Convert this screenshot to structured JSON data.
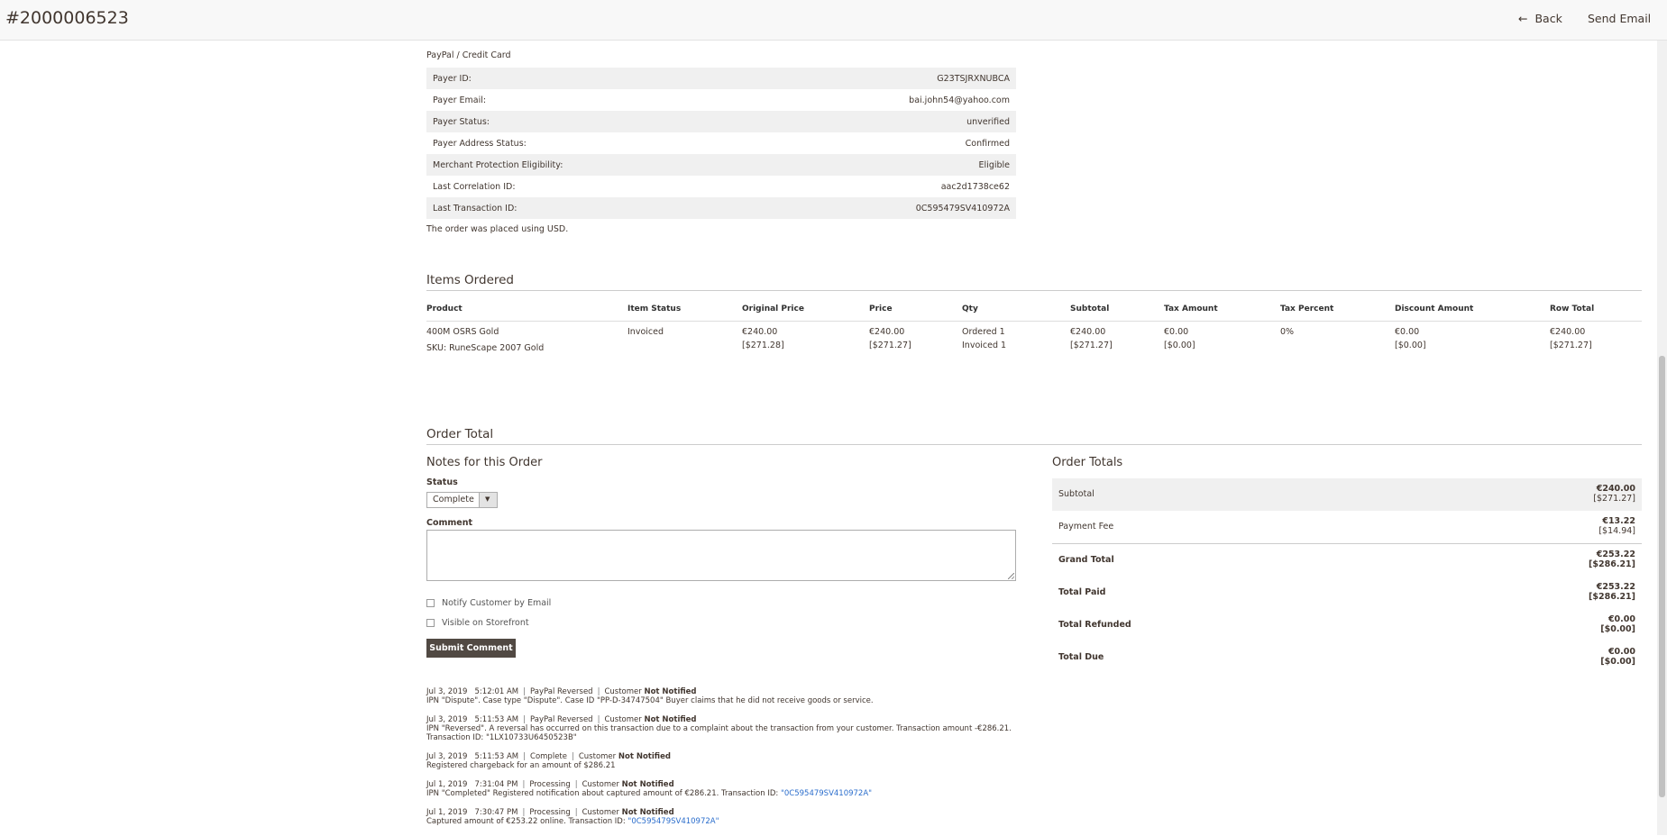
{
  "header": {
    "title": "#2000006523",
    "back_label": "Back",
    "send_email_label": "Send Email"
  },
  "payment": {
    "method": "PayPal / Credit Card",
    "rows": [
      {
        "label": "Payer ID:",
        "value": "G23TSJRXNUBCA"
      },
      {
        "label": "Payer Email:",
        "value": "bai.john54@yahoo.com"
      },
      {
        "label": "Payer Status:",
        "value": "unverified"
      },
      {
        "label": "Payer Address Status:",
        "value": "Confirmed"
      },
      {
        "label": "Merchant Protection Eligibility:",
        "value": "Eligible"
      },
      {
        "label": "Last Correlation ID:",
        "value": "aac2d1738ce62"
      },
      {
        "label": "Last Transaction ID:",
        "value": "0C595479SV410972A"
      }
    ],
    "note": "The order was placed using USD."
  },
  "items": {
    "title": "Items Ordered",
    "columns": [
      "Product",
      "Item Status",
      "Original Price",
      "Price",
      "Qty",
      "Subtotal",
      "Tax Amount",
      "Tax Percent",
      "Discount Amount",
      "Row Total"
    ],
    "row": {
      "product": "400M OSRS Gold",
      "sku": "SKU: RuneScape 2007 Gold",
      "status": "Invoiced",
      "orig_price": "€240.00",
      "orig_price_base": "[$271.28]",
      "price": "€240.00",
      "price_base": "[$271.27]",
      "qty_ordered": "Ordered 1",
      "qty_invoiced": "Invoiced 1",
      "subtotal": "€240.00",
      "subtotal_base": "[$271.27]",
      "tax_amount": "€0.00",
      "tax_amount_base": "[$0.00]",
      "tax_percent": "0%",
      "discount": "€0.00",
      "discount_base": "[$0.00]",
      "row_total": "€240.00",
      "row_total_base": "[$271.27]"
    }
  },
  "order_total": {
    "title": "Order Total",
    "notes_title": "Notes for this Order",
    "status_label": "Status",
    "status_value": "Complete",
    "comment_label": "Comment",
    "notify_label": "Notify Customer by Email",
    "visible_label": "Visible on Storefront",
    "submit_label": "Submit Comment"
  },
  "history": [
    {
      "date": "Jul 3, 2019",
      "time": "5:12:01 AM",
      "status": "PayPal Reversed",
      "customer": "Customer",
      "notified": "Not Notified",
      "text": "IPN \"Dispute\". Case type \"Dispute\". Case ID \"PP-D-34747504\" Buyer claims that he did not receive goods or service.",
      "link": ""
    },
    {
      "date": "Jul 3, 2019",
      "time": "5:11:53 AM",
      "status": "PayPal Reversed",
      "customer": "Customer",
      "notified": "Not Notified",
      "text": "IPN \"Reversed\". A reversal has occurred on this transaction due to a complaint about the transaction from your customer. Transaction amount -€286.21. Transaction ID: \"1LX10733U6450523B\"",
      "link": ""
    },
    {
      "date": "Jul 3, 2019",
      "time": "5:11:53 AM",
      "status": "Complete",
      "customer": "Customer",
      "notified": "Not Notified",
      "text": "Registered chargeback for an amount of $286.21",
      "link": ""
    },
    {
      "date": "Jul 1, 2019",
      "time": "7:31:04 PM",
      "status": "Processing",
      "customer": "Customer",
      "notified": "Not Notified",
      "text": "IPN \"Completed\" Registered notification about captured amount of €286.21. Transaction ID: ",
      "link": "\"0C595479SV410972A\""
    },
    {
      "date": "Jul 1, 2019",
      "time": "7:30:47 PM",
      "status": "Processing",
      "customer": "Customer",
      "notified": "Not Notified",
      "text": "Captured amount of €253.22 online. Transaction ID: ",
      "link": "\"0C595479SV410972A\""
    }
  ],
  "totals": {
    "title": "Order Totals",
    "rows": [
      {
        "label": "Subtotal",
        "value": "€240.00",
        "base": "[$271.27]"
      },
      {
        "label": "Payment Fee",
        "value": "€13.22",
        "base": "[$14.94]"
      },
      {
        "label": "Grand Total",
        "value": "€253.22",
        "base": "[$286.21]"
      },
      {
        "label": "Total Paid",
        "value": "€253.22",
        "base": "[$286.21]"
      },
      {
        "label": "Total Refunded",
        "value": "€0.00",
        "base": "[$0.00]"
      },
      {
        "label": "Total Due",
        "value": "€0.00",
        "base": "[$0.00]"
      }
    ]
  }
}
